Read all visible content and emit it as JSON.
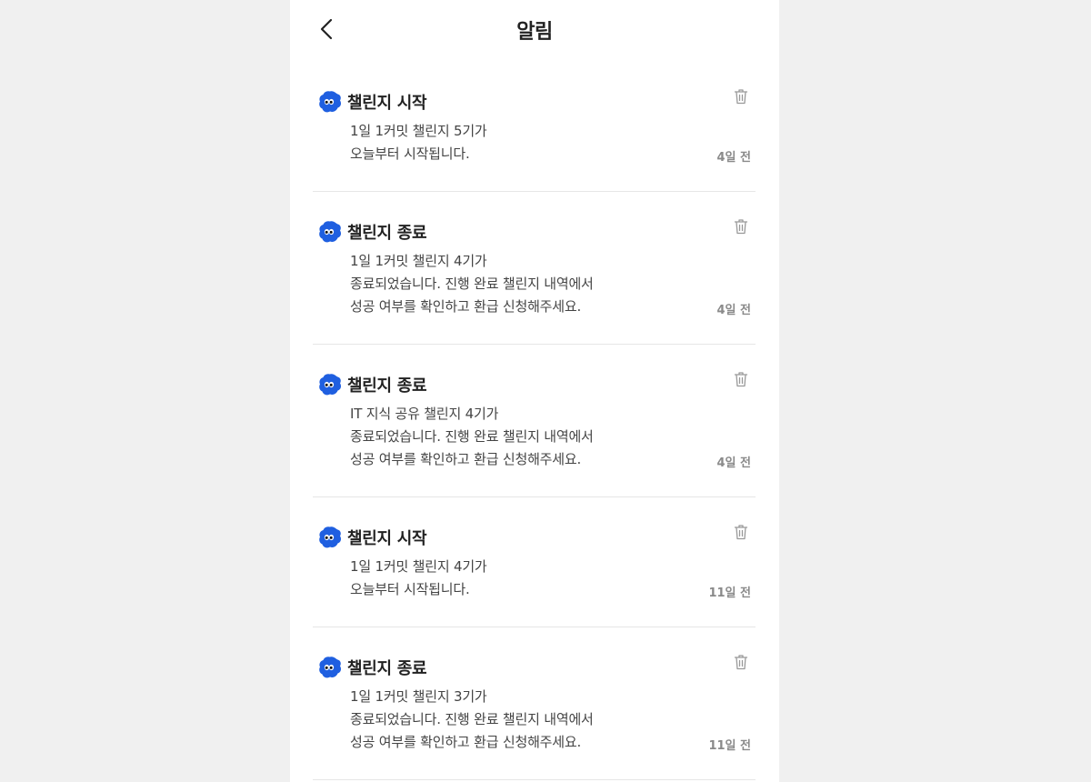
{
  "header": {
    "title": "알림"
  },
  "notifications": [
    {
      "title": "챌린지 시작",
      "lines": [
        "1일 1커밋 챌린지 5기가",
        "오늘부터 시작됩니다."
      ],
      "time": "4일 전"
    },
    {
      "title": "챌린지 종료",
      "lines": [
        "1일 1커밋 챌린지 4기가",
        "종료되었습니다. 진행 완료 챌린지 내역에서",
        "성공 여부를 확인하고 환급 신청해주세요."
      ],
      "time": "4일 전"
    },
    {
      "title": "챌린지 종료",
      "lines": [
        "IT 지식 공유 챌린지 4기가",
        "종료되었습니다. 진행 완료 챌린지 내역에서",
        "성공 여부를 확인하고 환급 신청해주세요."
      ],
      "time": "4일 전"
    },
    {
      "title": "챌린지 시작",
      "lines": [
        "1일 1커밋 챌린지 4기가",
        "오늘부터 시작됩니다."
      ],
      "time": "11일 전"
    },
    {
      "title": "챌린지 종료",
      "lines": [
        "1일 1커밋 챌린지 3기가",
        "종료되었습니다. 진행 완료 챌린지 내역에서",
        "성공 여부를 확인하고 환급 신청해주세요."
      ],
      "time": "11일 전"
    }
  ],
  "icons": {
    "back": "chevron-left-icon",
    "delete": "trash-icon",
    "avatar": "blob-character-icon"
  },
  "colors": {
    "brand": "#1f5fe0",
    "title": "#222222",
    "body": "#444444",
    "muted": "#8a8a8a",
    "divider": "#e6e6e6",
    "background": "#f0f0f0"
  }
}
